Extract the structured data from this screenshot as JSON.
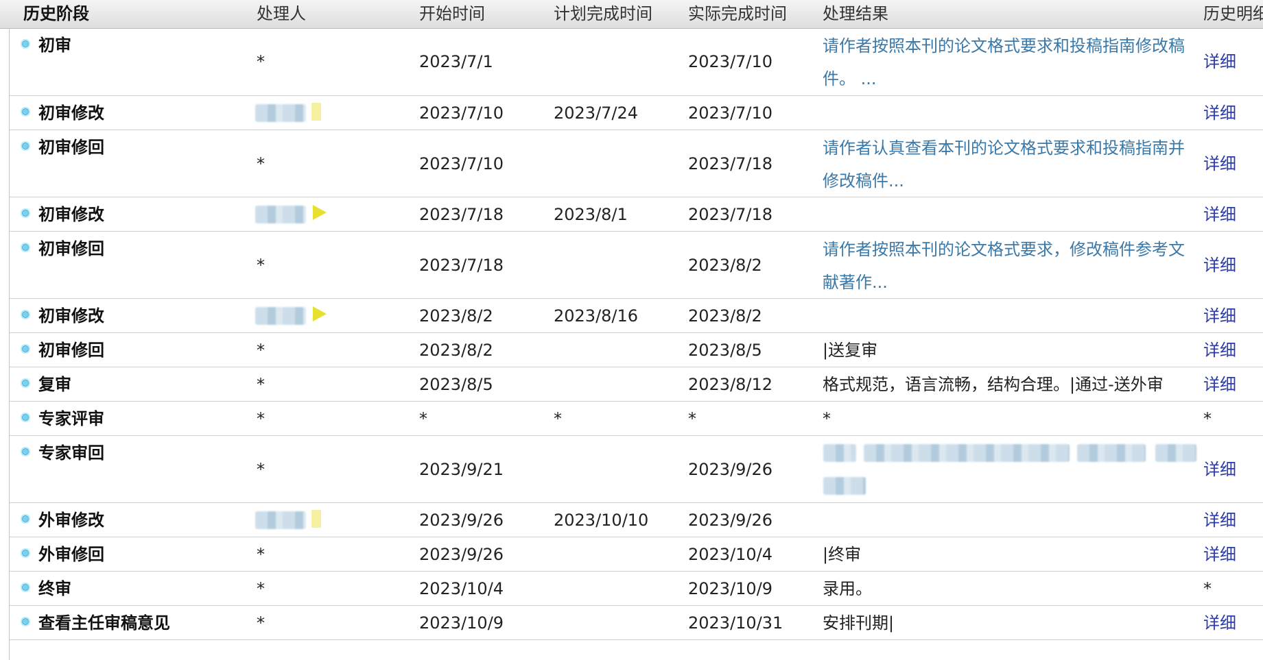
{
  "headers": [
    "历史阶段",
    "处理人",
    "开始时间",
    "计划完成时间",
    "实际完成时间",
    "处理结果",
    "历史明细"
  ],
  "rows": [
    {
      "stage": "初审",
      "handler": "*",
      "start": "2023/7/1",
      "plan": "",
      "actual": "2023/7/10",
      "result": "请作者按照本刊的论文格式要求和投稿指南修改稿件。 ...",
      "detail": "详细"
    },
    {
      "stage": "初审修改",
      "handler": "",
      "start": "2023/7/10",
      "plan": "2023/7/24",
      "actual": "2023/7/10",
      "result": "",
      "detail": "详细"
    },
    {
      "stage": "初审修回",
      "handler": "*",
      "start": "2023/7/10",
      "plan": "",
      "actual": "2023/7/18",
      "result": "请作者认真查看本刊的论文格式要求和投稿指南并修改稿件...",
      "detail": "详细"
    },
    {
      "stage": "初审修改",
      "handler": "",
      "start": "2023/7/18",
      "plan": "2023/8/1",
      "actual": "2023/7/18",
      "result": "",
      "detail": "详细"
    },
    {
      "stage": "初审修回",
      "handler": "*",
      "start": "2023/7/18",
      "plan": "",
      "actual": "2023/8/2",
      "result": "请作者按照本刊的论文格式要求，修改稿件参考文献著作...",
      "detail": "详细"
    },
    {
      "stage": "初审修改",
      "handler": "",
      "start": "2023/8/2",
      "plan": "2023/8/16",
      "actual": "2023/8/2",
      "result": "",
      "detail": "详细"
    },
    {
      "stage": "初审修回",
      "handler": "*",
      "start": "2023/8/2",
      "plan": "",
      "actual": "2023/8/5",
      "result": "|送复审",
      "detail": "详细"
    },
    {
      "stage": "复审",
      "handler": "*",
      "start": "2023/8/5",
      "plan": "",
      "actual": "2023/8/12",
      "result": "格式规范，语言流畅，结构合理。|通过-送外审",
      "detail": "详细"
    },
    {
      "stage": "专家评审",
      "handler": "*",
      "start": "*",
      "plan": "*",
      "actual": "*",
      "result": "*",
      "detail": "*"
    },
    {
      "stage": "专家审回",
      "handler": "*",
      "start": "2023/9/21",
      "plan": "",
      "actual": "2023/9/26",
      "result": "",
      "detail": "详细"
    },
    {
      "stage": "外审修改",
      "handler": "",
      "start": "2023/9/26",
      "plan": "2023/10/10",
      "actual": "2023/9/26",
      "result": "",
      "detail": "详细"
    },
    {
      "stage": "外审修回",
      "handler": "*",
      "start": "2023/9/26",
      "plan": "",
      "actual": "2023/10/4",
      "result": "|终审",
      "detail": "详细"
    },
    {
      "stage": "终审",
      "handler": "*",
      "start": "2023/10/4",
      "plan": "",
      "actual": "2023/10/9",
      "result": "录用。",
      "detail": "*"
    },
    {
      "stage": "查看主任审稿意见",
      "handler": "*",
      "start": "2023/10/9",
      "plan": "",
      "actual": "2023/10/31",
      "result": "安排刊期|",
      "detail": "详细"
    }
  ]
}
